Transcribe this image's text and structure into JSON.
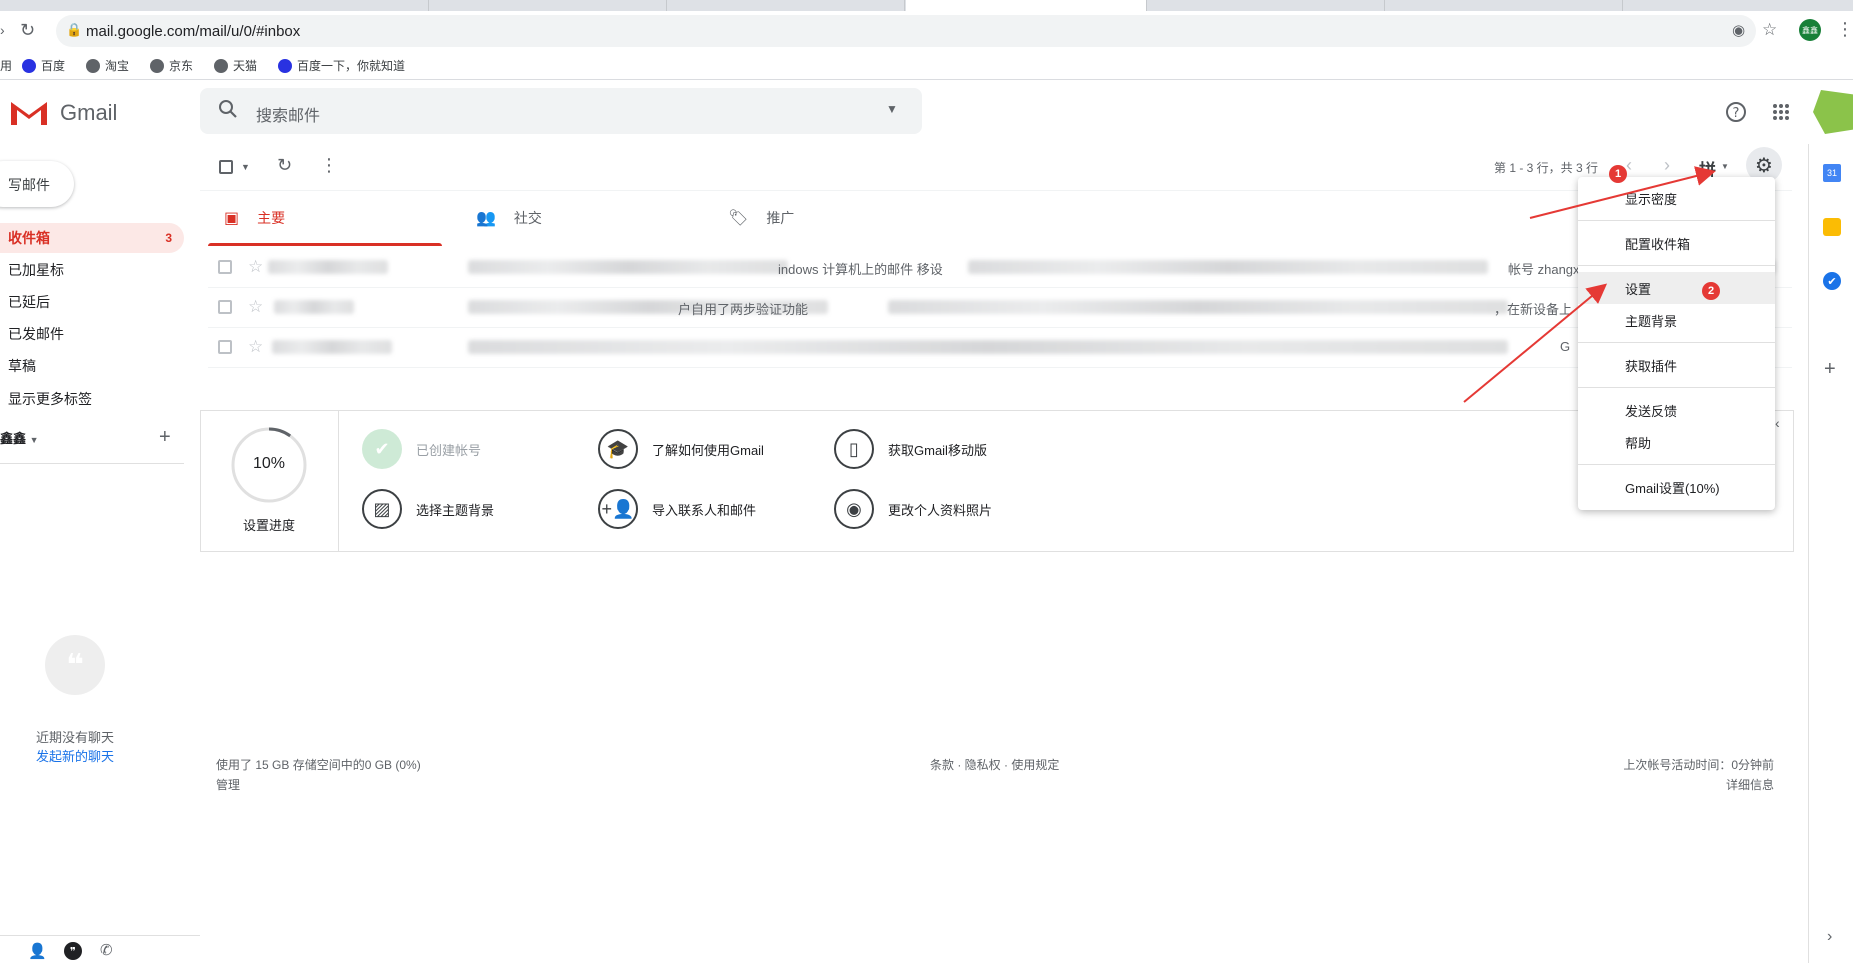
{
  "browser": {
    "url": "mail.google.com/mail/u/0/#inbox",
    "bookmarks": [
      {
        "label": "百度",
        "color": "#2932e1"
      },
      {
        "label": "淘宝",
        "color": "#5f6368"
      },
      {
        "label": "京东",
        "color": "#5f6368"
      },
      {
        "label": "天猫",
        "color": "#5f6368"
      },
      {
        "label": "百度一下，你就知道",
        "color": "#2932e1"
      }
    ],
    "profile_initials": "鑫鑫"
  },
  "header": {
    "app_name": "Gmail",
    "search_placeholder": "搜索邮件"
  },
  "sidebar": {
    "compose_label": "写邮件",
    "items": [
      {
        "label": "收件箱",
        "count": "3",
        "active": true
      },
      {
        "label": "已加星标",
        "count": ""
      },
      {
        "label": "已延后",
        "count": ""
      },
      {
        "label": "已发邮件",
        "count": ""
      },
      {
        "label": "草稿",
        "count": ""
      },
      {
        "label": "显示更多标签",
        "count": ""
      }
    ],
    "hangouts_user": "鑫鑫",
    "no_chat_text": "近期没有聊天",
    "start_chat_link": "发起新的聊天"
  },
  "toolbar": {
    "pagination": "第 1 - 3 行，共 3 行"
  },
  "tabs": [
    {
      "label": "主要",
      "icon": "inbox-icon",
      "active": true
    },
    {
      "label": "社交",
      "icon": "people-icon",
      "active": false
    },
    {
      "label": "推广",
      "icon": "tag-icon",
      "active": false
    }
  ],
  "emails": [
    {
      "visible_fragment": "indows 计算机上的邮件 移设",
      "visible_fragment_2": "帐号 zhangxi"
    },
    {
      "visible_fragment": "户自用了两步验证功能",
      "visible_fragment_2": "，在新设备上"
    },
    {
      "visible_fragment": "",
      "visible_fragment_2": "G"
    }
  ],
  "setup": {
    "progress": "10%",
    "progress_fraction": 0.1,
    "progress_label": "设置进度",
    "items": [
      {
        "label": "已创建帐号",
        "icon": "check-icon",
        "done": true
      },
      {
        "label": "了解如何使用Gmail",
        "icon": "graduation-cap-icon",
        "done": false
      },
      {
        "label": "获取Gmail移动版",
        "icon": "phone-icon",
        "done": false
      },
      {
        "label": "选择主题背景",
        "icon": "image-icon",
        "done": false
      },
      {
        "label": "导入联系人和邮件",
        "icon": "add-person-icon",
        "done": false
      },
      {
        "label": "更改个人资料照片",
        "icon": "account-icon",
        "done": false
      }
    ]
  },
  "settings_menu": {
    "items": [
      {
        "label": "显示密度"
      },
      {
        "label": "配置收件箱"
      },
      {
        "label": "设置"
      },
      {
        "label": "主题背景"
      },
      {
        "label": "获取插件"
      },
      {
        "label": "发送反馈"
      },
      {
        "label": "帮助"
      },
      {
        "label": "Gmail设置(10%)"
      }
    ]
  },
  "annotations": {
    "badge_1": "1",
    "badge_2": "2",
    "color": "#e53935"
  },
  "footer": {
    "storage": "使用了 15 GB 存储空间中的0 GB (0%)",
    "manage": "管理",
    "policies": "条款 · 隐私权 · 使用规定",
    "last_activity": "上次帐号活动时间：0分钟前",
    "details": "详细信息"
  }
}
